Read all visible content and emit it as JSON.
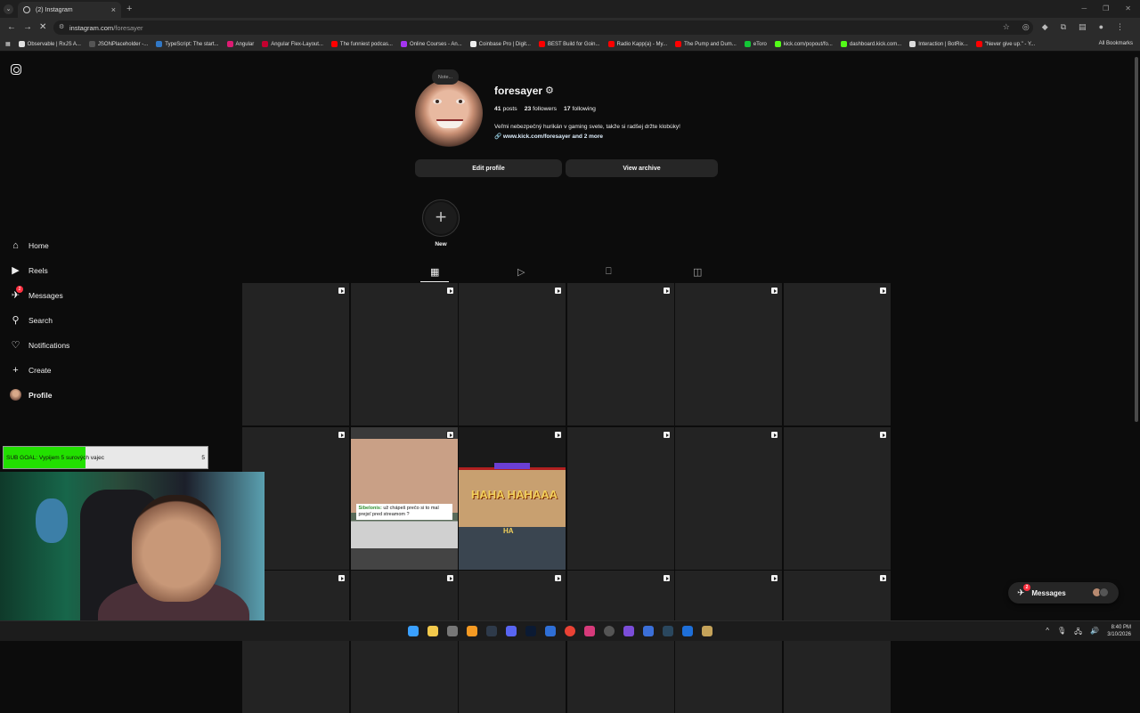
{
  "browser": {
    "tab_title": "(2) Instagram",
    "tab_close": "×",
    "new_tab": "+",
    "url_host": "instagram.com",
    "url_path": "/foresayer",
    "bookmarks": [
      {
        "label": "Observable | RxJS A...",
        "color": "#e0e0e0"
      },
      {
        "label": "JSONPlaceholder -...",
        "color": "#555555"
      },
      {
        "label": "TypeScript: The start...",
        "color": "#3178c6"
      },
      {
        "label": "Angular",
        "color": "#dd1b73"
      },
      {
        "label": "Angular Flex-Layout...",
        "color": "#c3002f"
      },
      {
        "label": "The funniest podcas...",
        "color": "#ff0000"
      },
      {
        "label": "Online Courses - An...",
        "color": "#a435f0"
      },
      {
        "label": "Coinbase Pro | Digit...",
        "color": "#eeeeee"
      },
      {
        "label": "BEST Build for Goin...",
        "color": "#ff0000"
      },
      {
        "label": "Radio Kapp(a) - My...",
        "color": "#ff0000"
      },
      {
        "label": "The Pump and Dum...",
        "color": "#ff0000"
      },
      {
        "label": "eToro",
        "color": "#13c636"
      },
      {
        "label": "kick.com/popout/fo...",
        "color": "#53fc18"
      },
      {
        "label": "dashboard.kick.com...",
        "color": "#53fc18"
      },
      {
        "label": "Interaction | BotRix...",
        "color": "#dddddd"
      },
      {
        "label": "\"Never give up.\" - Y...",
        "color": "#ff0000"
      }
    ],
    "all_bookmarks": "All Bookmarks"
  },
  "sidebar": {
    "items": [
      {
        "label": "Home",
        "icon": "home-icon",
        "glyph": "⌂"
      },
      {
        "label": "Reels",
        "icon": "reels-icon",
        "glyph": "▶"
      },
      {
        "label": "Messages",
        "icon": "messenger-icon",
        "glyph": "✈",
        "badge": "2"
      },
      {
        "label": "Search",
        "icon": "search-icon",
        "glyph": "⚲"
      },
      {
        "label": "Notifications",
        "icon": "heart-icon",
        "glyph": "♡"
      },
      {
        "label": "Create",
        "icon": "plus-icon",
        "glyph": "+"
      },
      {
        "label": "Profile",
        "icon": "avatar"
      }
    ]
  },
  "profile": {
    "note": "Note...",
    "username": "foresayer",
    "posts_count": "41",
    "posts_label": "posts",
    "followers_count": "23",
    "followers_label": "followers",
    "following_count": "17",
    "following_label": "following",
    "bio": "Veľmi nebezpečný hurikán v gaming svete, takže si radšej držte klobúky!",
    "link": "www.kick.com/foresayer and 2 more",
    "edit_button": "Edit profile",
    "archive_button": "View archive",
    "highlight_new": "New"
  },
  "posts": {
    "thumb1_caption_user": "Sibelonis:",
    "thumb1_caption_text": "už chápeš prečo si to mal prejsť pred streamom ?",
    "thumb2_text_big": "HAHA HAHAAA",
    "thumb2_text_small": "HA"
  },
  "overlay": {
    "sub_goal_label": "SUB GOAL: Vypijem 5 surových vajec",
    "sub_goal_count": "5",
    "sub_goal_progress": 0.4
  },
  "messages_pill": {
    "label": "Messages",
    "badge": "2"
  },
  "clock": {
    "time": "8:40 PM",
    "date": "3/10/2026"
  },
  "colors": {
    "background": "#0c0c0c",
    "button": "#262626",
    "badge": "#ff3040",
    "sub_goal_fill": "#22e000"
  }
}
